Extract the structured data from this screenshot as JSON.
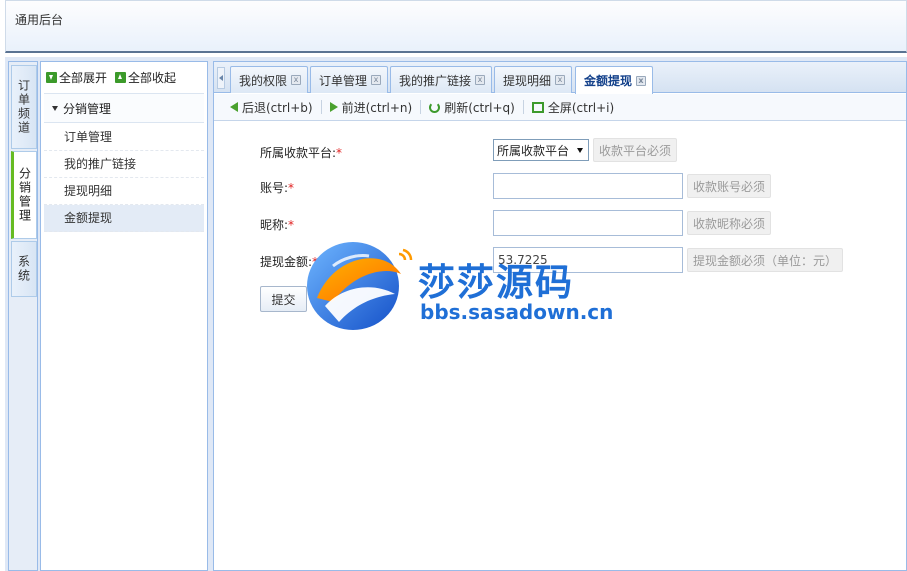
{
  "header": {
    "title": "通用后台"
  },
  "channels": [
    {
      "label": "订单频道",
      "active": false
    },
    {
      "label": "分销管理",
      "active": true
    },
    {
      "label": "系统",
      "active": false
    }
  ],
  "menu": {
    "expand_all": "全部展开",
    "collapse_all": "全部收起",
    "group_label": "分销管理",
    "items": [
      {
        "label": "订单管理"
      },
      {
        "label": "我的推广链接"
      },
      {
        "label": "提现明细"
      },
      {
        "label": "金额提现"
      }
    ]
  },
  "tabs": [
    {
      "label": "我的权限"
    },
    {
      "label": "订单管理"
    },
    {
      "label": "我的推广链接"
    },
    {
      "label": "提现明细"
    },
    {
      "label": "金额提现"
    }
  ],
  "toolbar": {
    "back": "后退(ctrl+b)",
    "forward": "前进(ctrl+n)",
    "refresh": "刷新(ctrl+q)",
    "fullscreen": "全屏(ctrl+i)"
  },
  "form": {
    "platform_label": "所属收款平台:",
    "platform_value": "所属收款平台",
    "platform_hint": "收款平台必须",
    "account_label": "账号:",
    "account_value": "",
    "account_hint": "收款账号必须",
    "nickname_label": "昵称:",
    "nickname_value": "",
    "nickname_hint": "收款昵称必须",
    "amount_label": "提现金额:",
    "amount_value": "53.7225",
    "amount_hint": "提现金额必须（单位：元）",
    "required_mark": "*",
    "submit_label": "提交",
    "reset_label": ""
  },
  "watermark": {
    "brand": "莎莎源码",
    "url": "bbs.sasadown.cn"
  }
}
